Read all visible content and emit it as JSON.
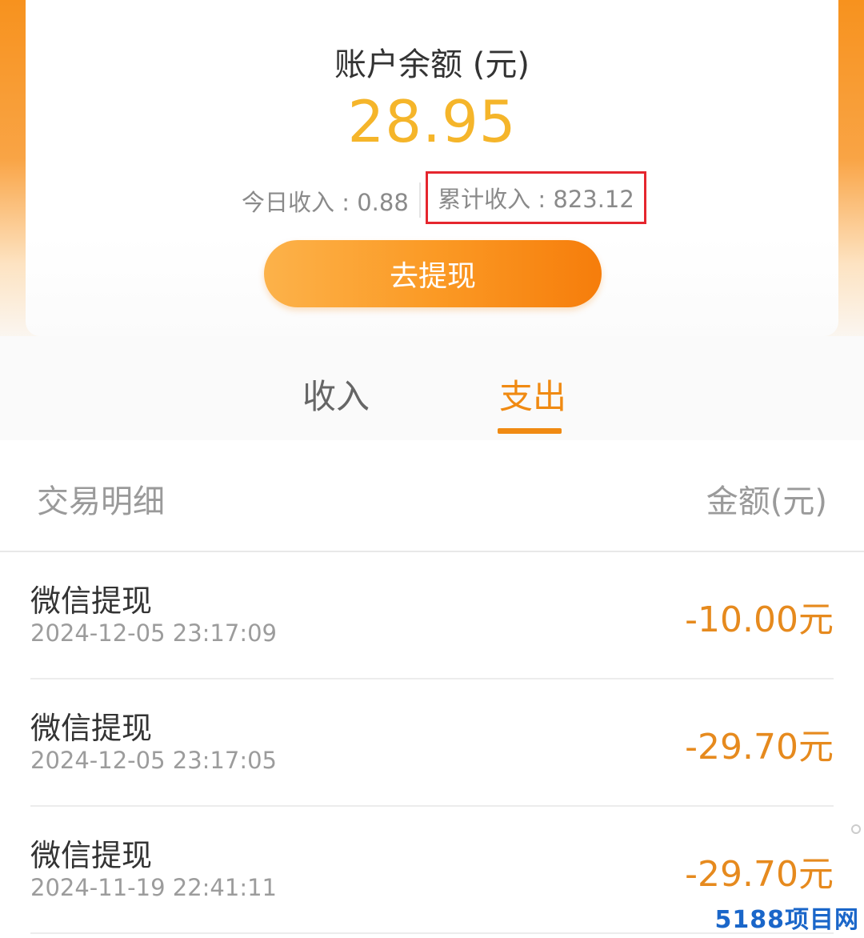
{
  "balance": {
    "title": "账户余额 (元)",
    "value": "28.95",
    "today_income": "今日收入 : 0.88",
    "total_income": "累计收入 : 823.12",
    "withdraw_label": "去提现"
  },
  "tabs": [
    {
      "label": "收入",
      "active": false
    },
    {
      "label": "支出",
      "active": true
    }
  ],
  "list_header": {
    "left": "交易明细",
    "right": "金额(元)"
  },
  "transactions": [
    {
      "name": "微信提现",
      "time": "2024-12-05 23:17:09",
      "amount": "-10.00元"
    },
    {
      "name": "微信提现",
      "time": "2024-12-05 23:17:05",
      "amount": "-29.70元"
    },
    {
      "name": "微信提现",
      "time": "2024-11-19 22:41:11",
      "amount": "-29.70元"
    }
  ],
  "watermark": "5188项目网",
  "colors": {
    "accent": "#f08a12",
    "balance": "#f5b52a",
    "highlight_box": "#e5262e",
    "watermark": "#1a66c9"
  }
}
